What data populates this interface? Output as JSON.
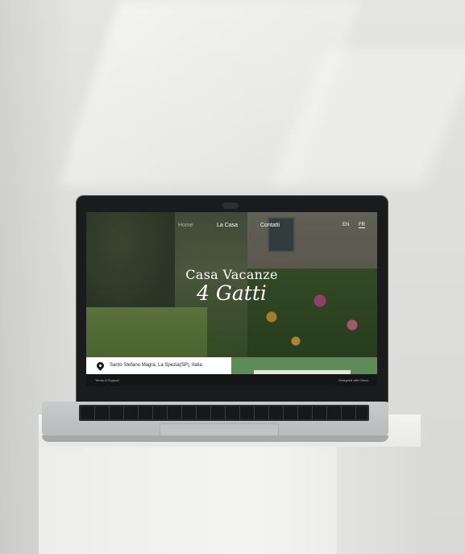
{
  "site": {
    "nav": {
      "home": "Home",
      "casa": "La Casa",
      "contatti": "Contatti"
    },
    "languages": {
      "en": "EN",
      "fr": "FR",
      "selected": "FR"
    },
    "hero": {
      "title_line1": "Casa Vacanze",
      "title_line2": "4 Gatti"
    },
    "address": "Santo Stefano Magra, La Spezia(SP), Italia",
    "footer": {
      "left": "Terms & Support",
      "right": "Designed with Cleon"
    }
  },
  "colors": {
    "accent_green": "#5f8a5a",
    "footer_bg": "#141516"
  }
}
